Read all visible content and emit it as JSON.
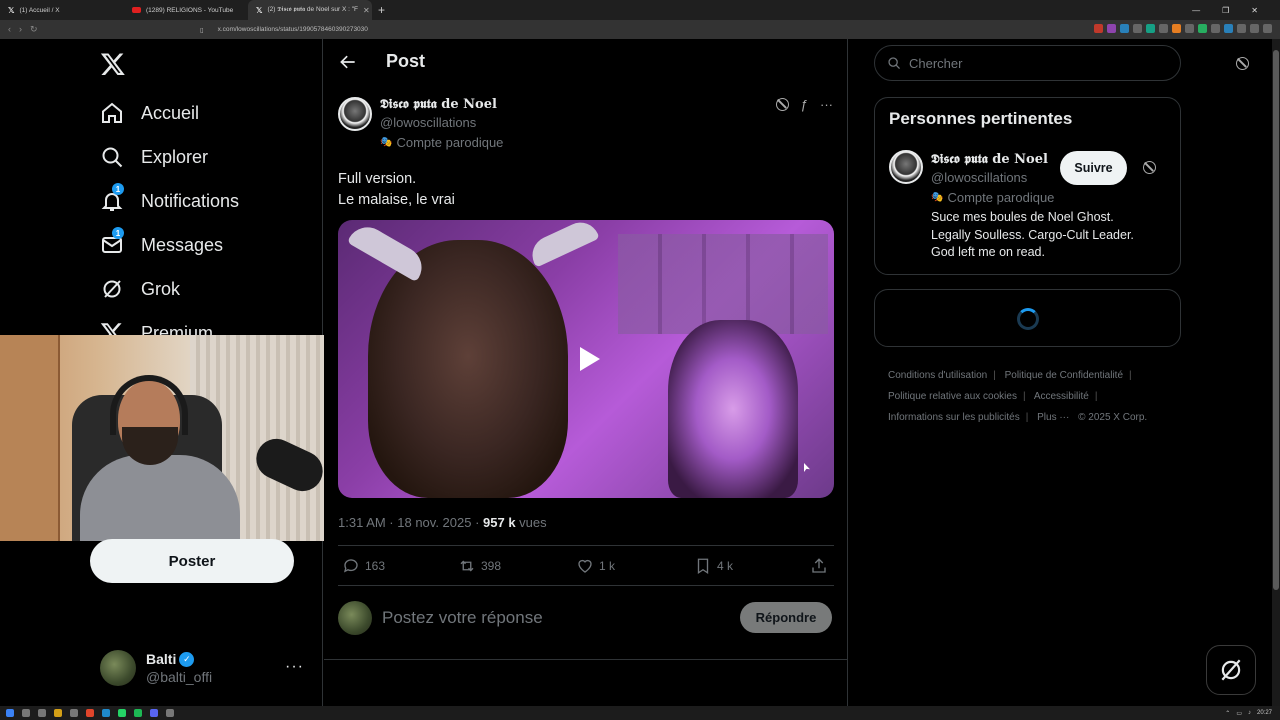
{
  "browser": {
    "tabs": [
      {
        "label": "(1) Accueil / X",
        "icon": "x-logo-icon"
      },
      {
        "label": "(1289) RELIGIONS - YouTube",
        "icon": "youtube-icon"
      },
      {
        "label": "(2) 𝕯𝖎𝖘𝖈𝖔 𝖕𝖚𝖙𝖆 de Noel sur X : \"F",
        "icon": "x-logo-icon"
      }
    ],
    "url": "x.com/lowoscillations/status/1990578460390273030"
  },
  "sidebar": {
    "nav": [
      {
        "label": "Accueil",
        "icon": "home-icon"
      },
      {
        "label": "Explorer",
        "icon": "search-icon"
      },
      {
        "label": "Notifications",
        "icon": "bell-icon",
        "badge": "1"
      },
      {
        "label": "Messages",
        "icon": "mail-icon",
        "badge": "1"
      },
      {
        "label": "Grok",
        "icon": "grok-icon"
      },
      {
        "label": "Premium",
        "icon": "x-logo-icon"
      }
    ],
    "post_button": "Poster",
    "account": {
      "name": "Balti",
      "handle": "@balti_offi",
      "verified": true
    }
  },
  "main": {
    "header_title": "Post",
    "author": {
      "name": "𝕯𝖎𝖘𝖈𝖔 𝖕𝖚𝖙𝖆 de Noel",
      "handle": "@lowoscillations",
      "parody_label": "Compte parodique"
    },
    "text_line1": "Full version.",
    "text_line2": "Le malaise, le vrai",
    "meta": {
      "time": "1:31 AM · 18 nov. 2025 · ",
      "views_count": "957 k",
      "views_label": " vues"
    },
    "engagement": {
      "replies": "163",
      "reposts": "398",
      "likes": "1 k",
      "bookmarks": "4 k"
    },
    "reply_placeholder": "Postez votre réponse",
    "reply_button": "Répondre"
  },
  "right": {
    "search_placeholder": "Chercher",
    "people_title": "Personnes pertinentes",
    "person": {
      "name": "𝕯𝖎𝖘𝖈𝖔 𝖕𝖚𝖙𝖆 de Noel",
      "handle": "@lowoscillations",
      "parody_label": "Compte parodique",
      "bio_line1": "Suce mes boules de Noel Ghost.",
      "bio_line2": "Legally Soulless. Cargo-Cult Leader.",
      "bio_line3": "God left me on read.",
      "follow": "Suivre"
    },
    "footer": {
      "terms": "Conditions d'utilisation",
      "privacy": "Politique de Confidentialité",
      "cookies": "Politique relative aux cookies",
      "accessibility": "Accessibilité",
      "ads": "Informations sur les publicités",
      "more": "Plus ···",
      "copyright": "© 2025 X Corp."
    }
  },
  "taskbar": {
    "time": "20:27"
  },
  "colors": {
    "accent": "#1d9bf0",
    "background": "#000000",
    "border": "#2f3336",
    "muted": "#71767b"
  }
}
